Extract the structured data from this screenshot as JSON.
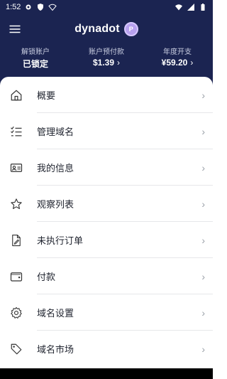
{
  "status_bar": {
    "time": "1:52",
    "left_icons": [
      "gear-icon",
      "shield-icon",
      "wifi-outline-icon"
    ],
    "right_icons": [
      "wifi-icon",
      "signal-icon",
      "battery-icon"
    ]
  },
  "app_bar": {
    "menu_icon": "hamburger-menu-icon",
    "brand": "dynadot",
    "badge": "P"
  },
  "stats": [
    {
      "label": "解锁账户",
      "value": "已锁定",
      "has_chevron": false
    },
    {
      "label": "账户预付款",
      "value": "$1.39",
      "has_chevron": true
    },
    {
      "label": "年度开支",
      "value": "¥59.20",
      "has_chevron": true
    }
  ],
  "menu": [
    {
      "label": "概要",
      "icon": "home-icon"
    },
    {
      "label": "管理域名",
      "icon": "checklist-icon"
    },
    {
      "label": "我的信息",
      "icon": "id-card-icon"
    },
    {
      "label": "观察列表",
      "icon": "star-icon"
    },
    {
      "label": "未执行订单",
      "icon": "edit-document-icon"
    },
    {
      "label": "付款",
      "icon": "wallet-icon"
    },
    {
      "label": "域名设置",
      "icon": "gear-icon"
    },
    {
      "label": "域名市场",
      "icon": "tag-icon"
    }
  ],
  "chevron": "›",
  "colors": {
    "header_bg": "#1b2451",
    "badge": "#b8a1ee",
    "text": "#222631",
    "divider": "#e6e7ea"
  }
}
